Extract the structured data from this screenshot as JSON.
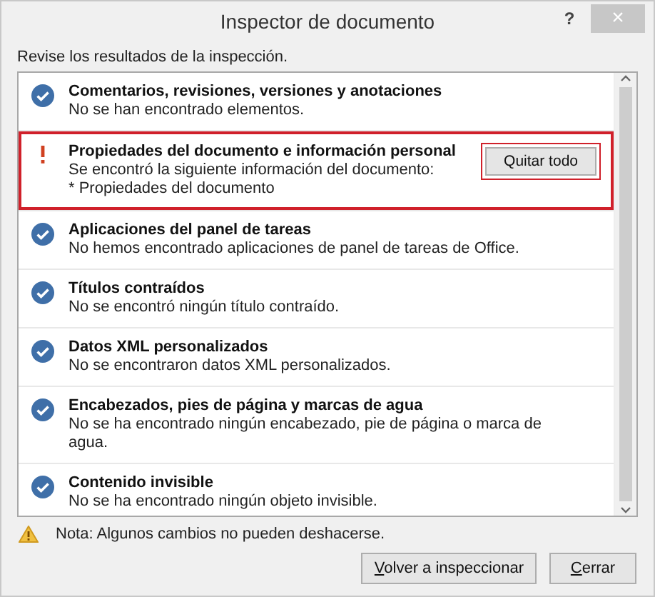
{
  "window": {
    "title": "Inspector de documento",
    "help": "?",
    "close": "×"
  },
  "instruction": "Revise los resultados de la inspección.",
  "results": [
    {
      "kind": "ok",
      "title": "Comentarios, revisiones, versiones y anotaciones",
      "details": [
        "No se han encontrado elementos."
      ]
    },
    {
      "kind": "found",
      "title": "Propiedades del documento e información personal",
      "details": [
        "Se encontró la siguiente información del documento:",
        "* Propiedades del documento"
      ],
      "action": "Quitar todo"
    },
    {
      "kind": "ok",
      "title": "Aplicaciones del panel de tareas",
      "details": [
        "No hemos encontrado aplicaciones de panel de tareas de Office."
      ]
    },
    {
      "kind": "ok",
      "title": "Títulos contraídos",
      "details": [
        "No se encontró ningún título contraído."
      ]
    },
    {
      "kind": "ok",
      "title": "Datos XML personalizados",
      "details": [
        "No se encontraron datos XML personalizados."
      ]
    },
    {
      "kind": "ok",
      "title": "Encabezados, pies de página y marcas de agua",
      "details": [
        "No se ha encontrado ningún encabezado, pie de página o marca de agua."
      ]
    },
    {
      "kind": "ok",
      "title": "Contenido invisible",
      "details": [
        "No se ha encontrado ningún objeto invisible."
      ]
    }
  ],
  "note": "Nota: Algunos cambios no pueden deshacerse.",
  "buttons": [
    "Volver a inspeccionar",
    "Cerrar"
  ]
}
